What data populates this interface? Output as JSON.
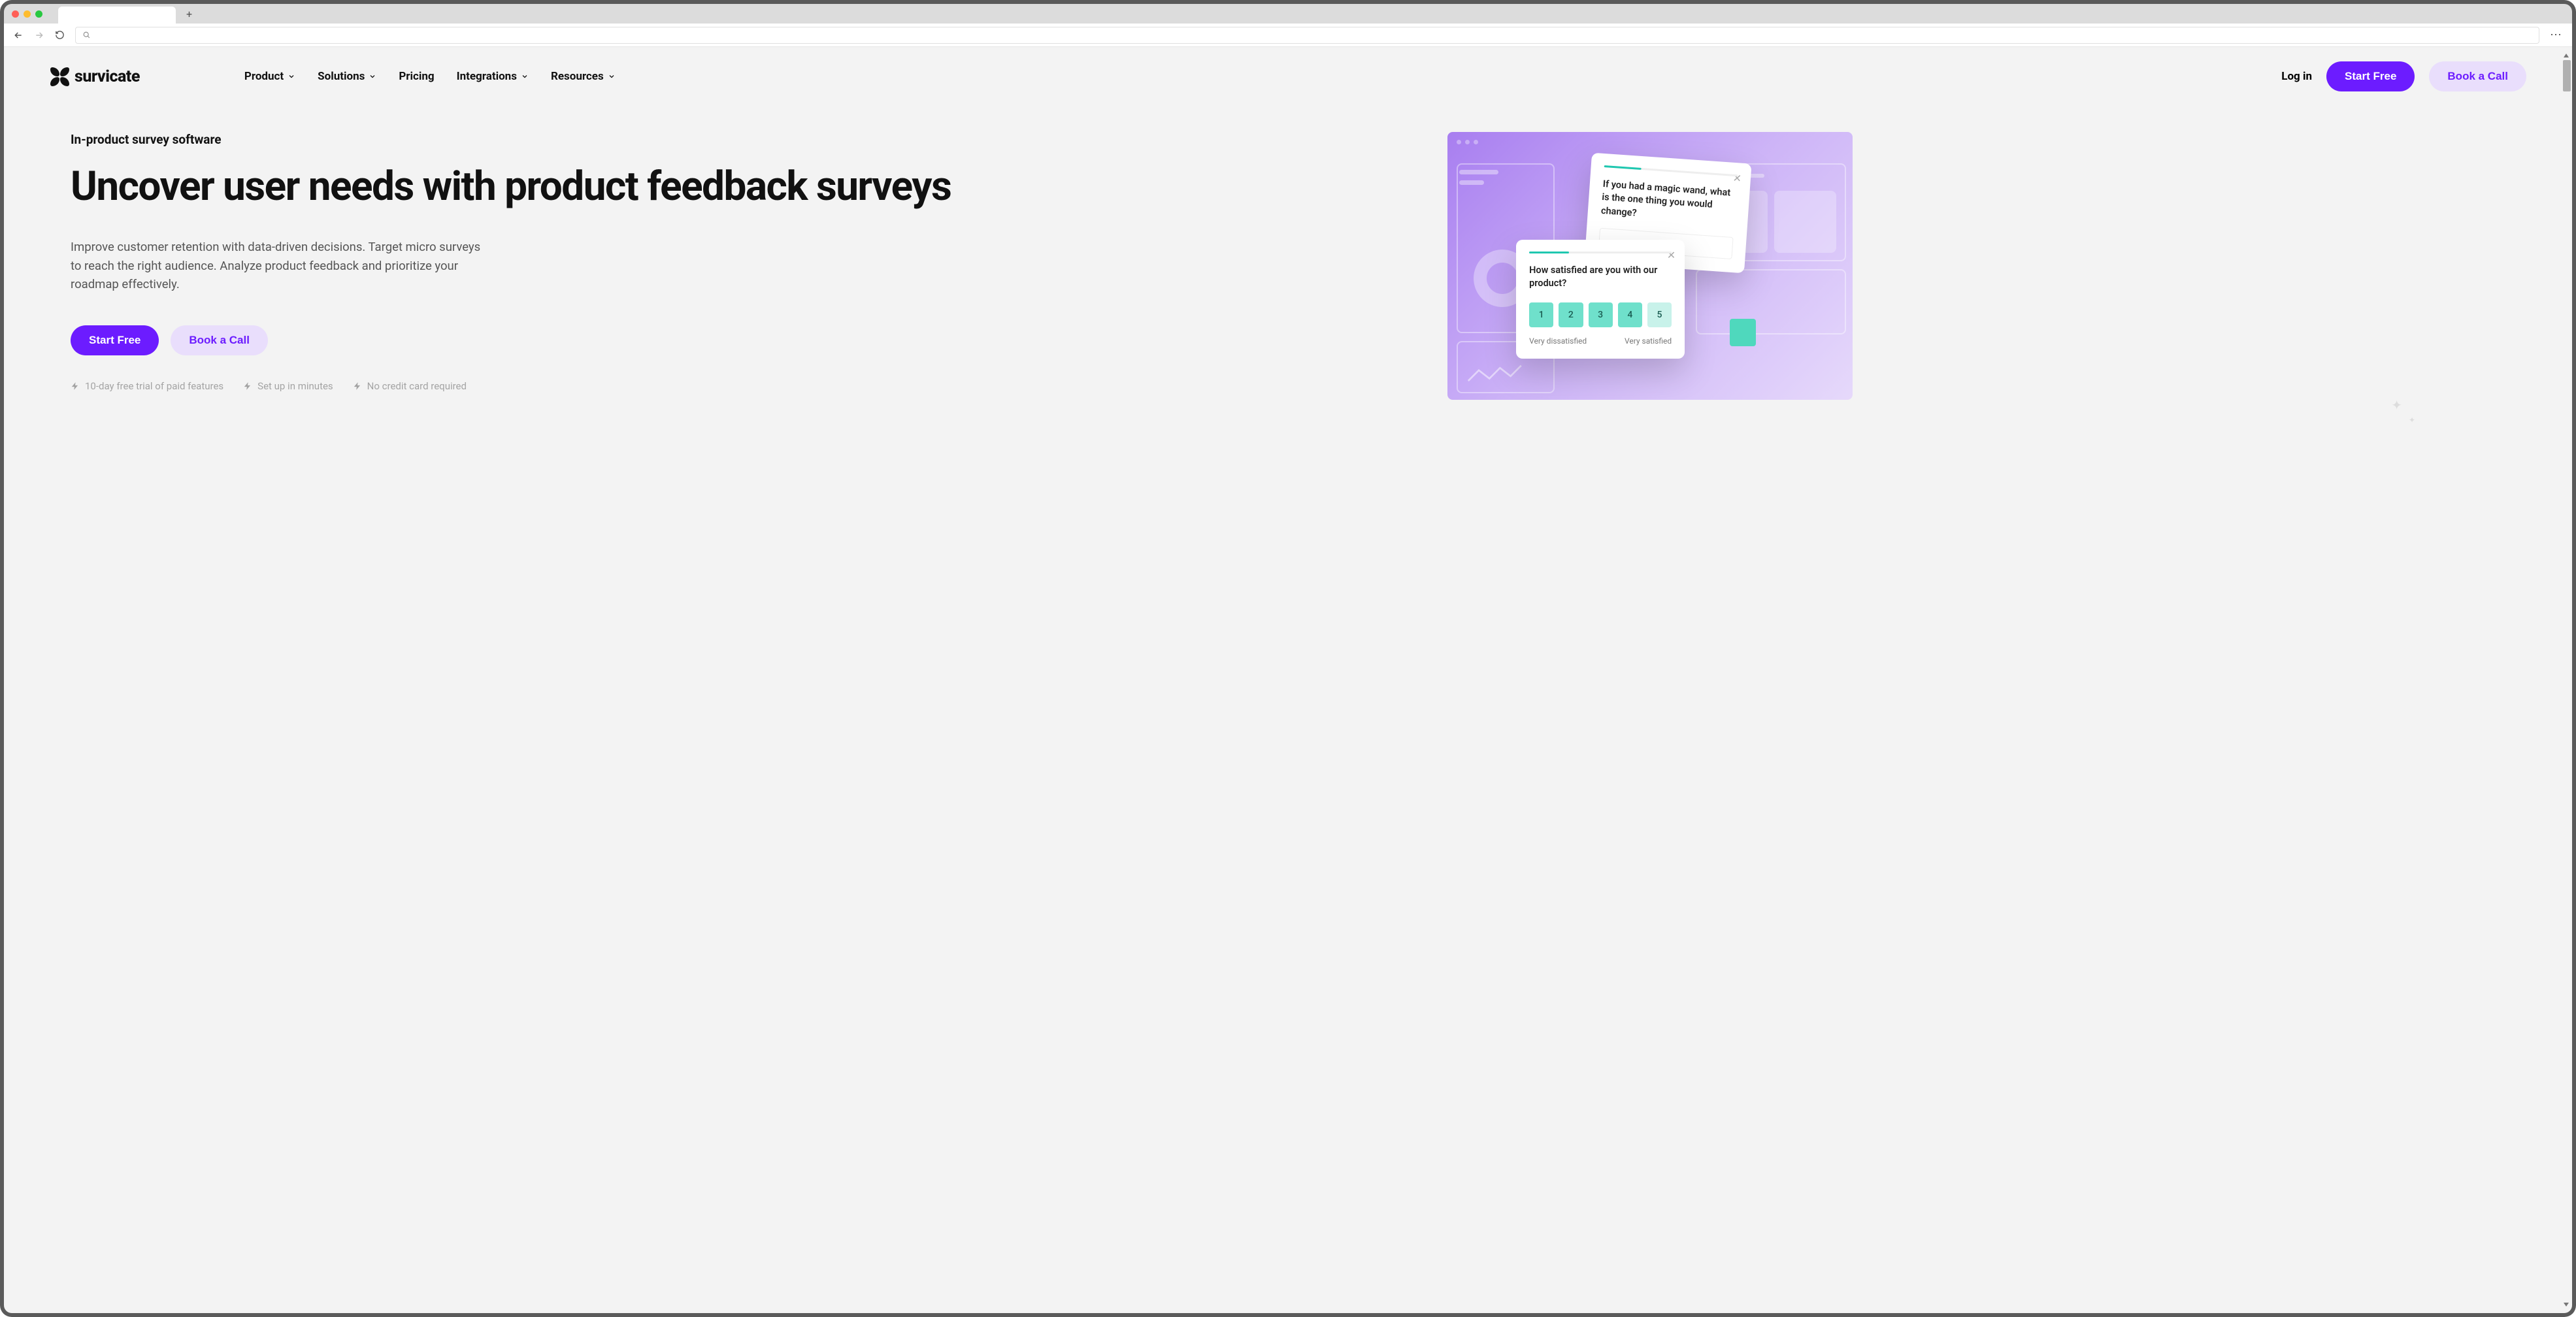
{
  "nav": {
    "items": [
      {
        "label": "Product",
        "hasDropdown": true
      },
      {
        "label": "Solutions",
        "hasDropdown": true
      },
      {
        "label": "Pricing",
        "hasDropdown": false
      },
      {
        "label": "Integrations",
        "hasDropdown": true
      },
      {
        "label": "Resources",
        "hasDropdown": true
      }
    ],
    "login": "Log in",
    "startFree": "Start Free",
    "bookCall": "Book a Call"
  },
  "logo": {
    "text": "survicate"
  },
  "hero": {
    "eyebrow": "In-product survey software",
    "title": "Uncover user needs with product feedback surveys",
    "description": "Improve customer retention with data-driven decisions. Target micro surveys to reach the right audience. Analyze product feedback and prioritize your roadmap effectively.",
    "ctaPrimary": "Start Free",
    "ctaSecondary": "Book a Call",
    "trust": [
      "10-day free trial of paid features",
      "Set up in minutes",
      "No credit card required"
    ]
  },
  "illustration": {
    "card1": {
      "question": "If you had a magic wand, what is the one thing you would change?"
    },
    "card2": {
      "question": "How satisfied are you with our product?",
      "ratings": [
        "1",
        "2",
        "3",
        "4",
        "5"
      ],
      "labelLow": "Very dissatisfied",
      "labelHigh": "Very satisfied"
    }
  }
}
